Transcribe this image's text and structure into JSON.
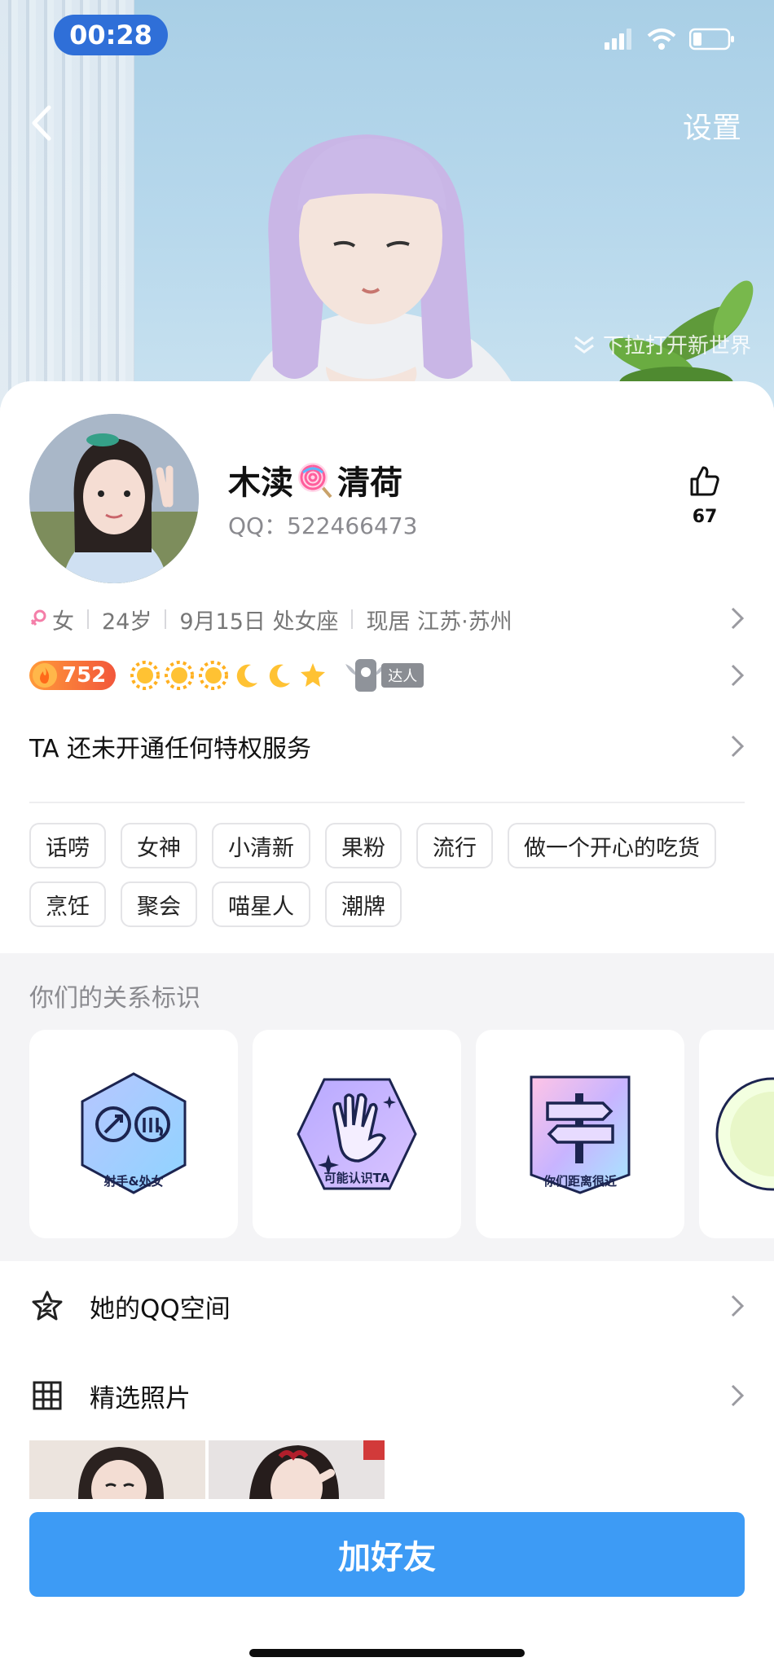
{
  "status_bar": {
    "time": "00:28"
  },
  "header": {
    "settings_label": "设置",
    "pull_hint": "下拉打开新世界"
  },
  "profile": {
    "name_part1": "木渎",
    "name_part2": "清荷",
    "qq_label": "QQ：522466473",
    "likes": "67"
  },
  "info": {
    "gender": "女",
    "age": "24岁",
    "birthday": "9月15日 处女座",
    "location": "现居 江苏·苏州"
  },
  "level": {
    "value": "752",
    "talent_label": "达人"
  },
  "privilege_text": "TA 还未开通任何特权服务",
  "tags": [
    "话唠",
    "女神",
    "小清新",
    "果粉",
    "流行",
    "做一个开心的吃货",
    "烹饪",
    "聚会",
    "喵星人",
    "潮牌"
  ],
  "relations": {
    "title": "你们的关系标识",
    "badges": [
      {
        "label": "射手&处女"
      },
      {
        "label": "可能认识TA"
      },
      {
        "label": "你们距离很近"
      }
    ]
  },
  "links": {
    "qzone": "她的QQ空间",
    "photos": "精选照片"
  },
  "add_friend_label": "加好友",
  "colors": {
    "accent": "#3d9bf5",
    "level": "#f2573b"
  }
}
